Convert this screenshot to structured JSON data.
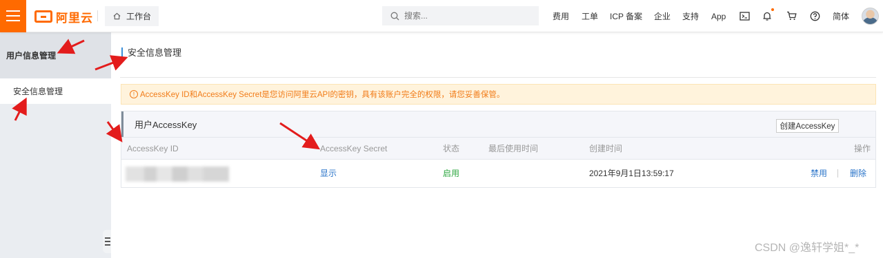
{
  "topbar": {
    "logo_text": "阿里云",
    "workbench_label": "工作台",
    "search_placeholder": "搜索...",
    "nav": [
      "费用",
      "工单",
      "ICP 备案",
      "企业",
      "支持",
      "App"
    ],
    "language": "简体",
    "accent_color": "#ff6a00",
    "icons": [
      "menu-icon",
      "home-icon",
      "search-icon",
      "terminal-icon",
      "bell-icon",
      "cart-icon",
      "help-icon",
      "avatar"
    ]
  },
  "sidebar": {
    "header": "用户信息管理",
    "items": [
      {
        "label": "安全信息管理",
        "active": true
      }
    ]
  },
  "main": {
    "page_title": "安全信息管理",
    "notice": "AccessKey ID和AccessKey Secret是您访问阿里云API的密钥，具有该账户完全的权限，请您妥善保管。",
    "panel": {
      "title": "用户AccessKey",
      "create_button": "创建AccessKey",
      "columns": [
        "AccessKey ID",
        "AccessKey Secret",
        "状态",
        "最后使用时间",
        "创建时间",
        "操作"
      ],
      "rows": [
        {
          "secret_action": "显示",
          "status": "启用",
          "last_used": "",
          "created": "2021年9月1日13:59:17",
          "actions": [
            "禁用",
            "删除"
          ]
        }
      ]
    }
  },
  "watermark": "CSDN @逸轩学姐*_*"
}
